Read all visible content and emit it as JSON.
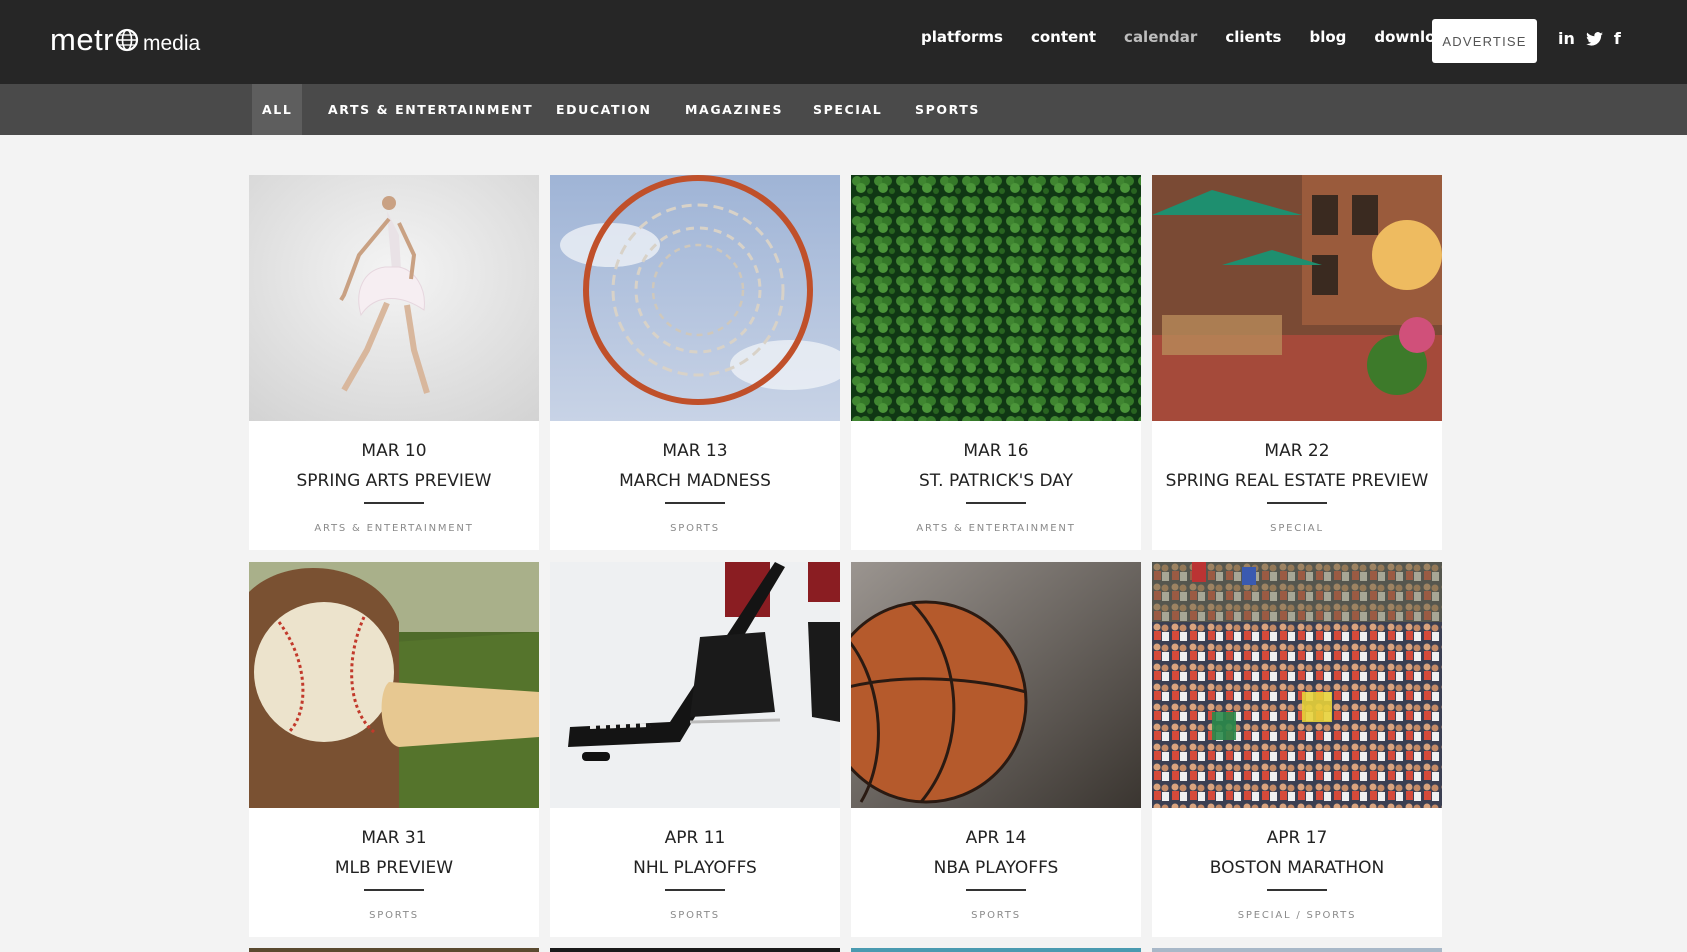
{
  "header": {
    "logo_word": "metr",
    "logo_sub": "media",
    "nav": [
      "platforms",
      "content",
      "calendar",
      "clients",
      "blog",
      "download"
    ],
    "advertise_label": "ADVERTISE",
    "social": [
      "in",
      "t",
      "f"
    ]
  },
  "filters": [
    "ALL",
    "ARTS & ENTERTAINMENT",
    "EDUCATION",
    "MAGAZINES",
    "SPECIAL",
    "SPORTS"
  ],
  "cards": [
    {
      "date": "MAR 10",
      "title": "SPRING ARTS PREVIEW",
      "category": "ARTS & ENTERTAINMENT",
      "image": "ballet-dancer"
    },
    {
      "date": "MAR 13",
      "title": "MARCH MADNESS",
      "category": "SPORTS",
      "image": "basketball-hoop"
    },
    {
      "date": "MAR 16",
      "title": "ST. PATRICK'S DAY",
      "category": "ARTS & ENTERTAINMENT",
      "image": "clover-field"
    },
    {
      "date": "MAR 22",
      "title": "SPRING REAL ESTATE PREVIEW",
      "category": "SPECIAL",
      "image": "street-cafe"
    },
    {
      "date": "MAR 31",
      "title": "MLB PREVIEW",
      "category": "SPORTS",
      "image": "baseball-glove"
    },
    {
      "date": "APR 11",
      "title": "NHL PLAYOFFS",
      "category": "SPORTS",
      "image": "hockey-stick"
    },
    {
      "date": "APR 14",
      "title": "NBA PLAYOFFS",
      "category": "SPORTS",
      "image": "basketball"
    },
    {
      "date": "APR 17",
      "title": "BOSTON MARATHON",
      "category": "SPECIAL / SPORTS",
      "image": "marathon-crowd"
    }
  ]
}
